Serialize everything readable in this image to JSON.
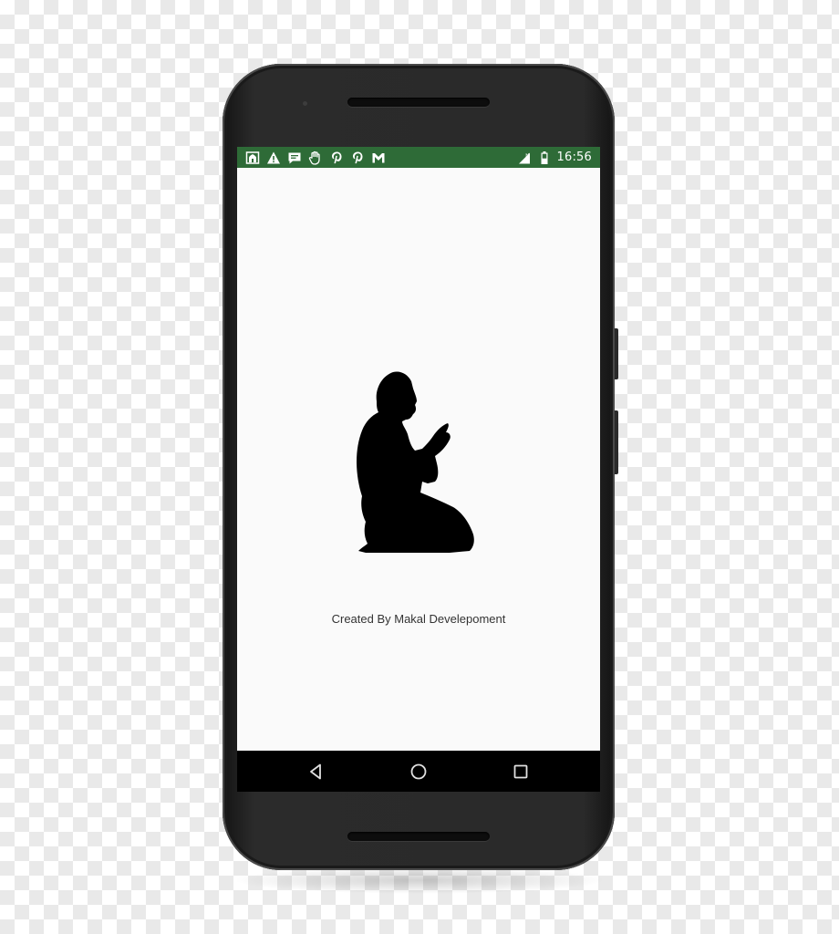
{
  "status_bar": {
    "background_color": "#2e6b37",
    "left_icons": [
      "mosque-icon",
      "warning-icon",
      "chat-icon",
      "hand-icon",
      "pinterest-icon",
      "pinterest-icon",
      "gmail-icon"
    ],
    "right_icons": [
      "signal-icon",
      "battery-icon"
    ],
    "time": "16:56"
  },
  "splash": {
    "logo_icon": "praying-man-silhouette-icon",
    "credit_text": "Created By Makal Develepoment"
  },
  "nav_bar": {
    "buttons": [
      "back-icon",
      "home-icon",
      "recents-icon"
    ]
  }
}
